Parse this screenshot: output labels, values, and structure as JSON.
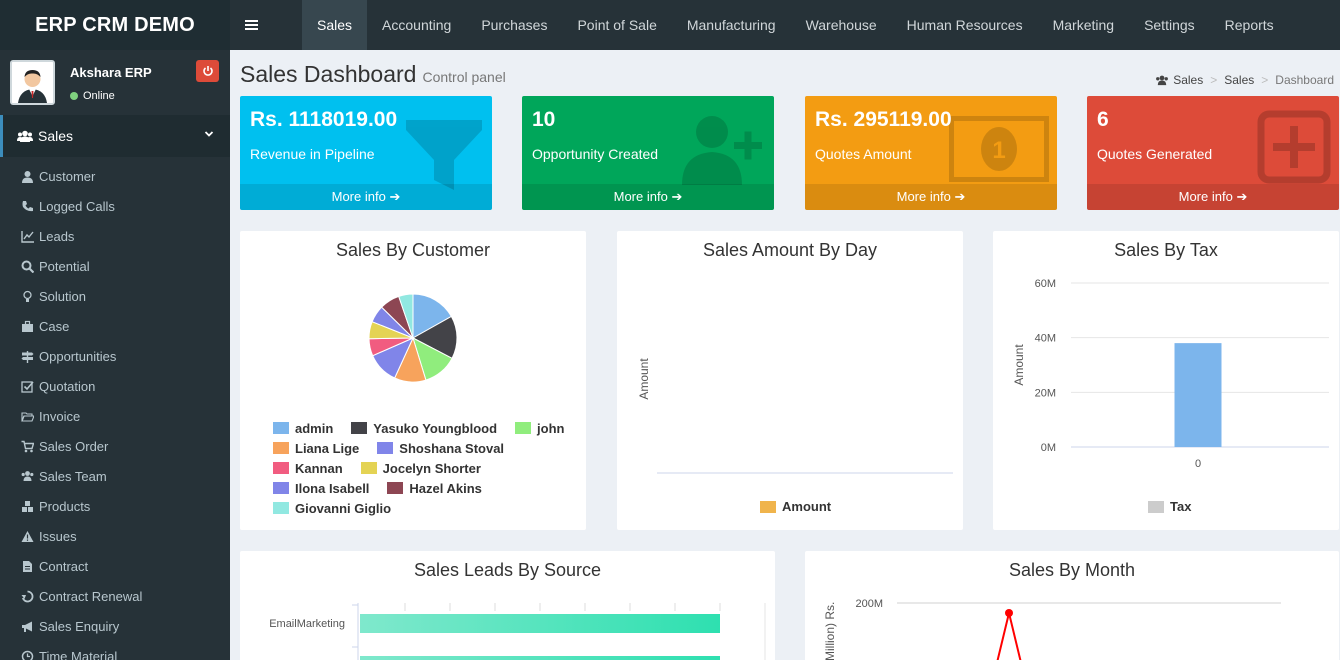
{
  "app": {
    "logo": "ERP CRM DEMO"
  },
  "topnav": [
    {
      "label": "Sales",
      "active": true
    },
    {
      "label": "Accounting"
    },
    {
      "label": "Purchases"
    },
    {
      "label": "Point of Sale"
    },
    {
      "label": "Manufacturing"
    },
    {
      "label": "Warehouse"
    },
    {
      "label": "Human Resources"
    },
    {
      "label": "Marketing"
    },
    {
      "label": "Settings"
    },
    {
      "label": "Reports"
    }
  ],
  "user": {
    "name": "Akshara ERP",
    "status": "Online"
  },
  "sidebar": {
    "section": "Sales",
    "items": [
      {
        "label": "Customer",
        "icon": "user-icon"
      },
      {
        "label": "Logged Calls",
        "icon": "phone-icon"
      },
      {
        "label": "Leads",
        "icon": "line-chart-icon"
      },
      {
        "label": "Potential",
        "icon": "search-icon"
      },
      {
        "label": "Solution",
        "icon": "lightbulb-icon"
      },
      {
        "label": "Case",
        "icon": "briefcase-icon"
      },
      {
        "label": "Opportunities",
        "icon": "signpost-icon"
      },
      {
        "label": "Quotation",
        "icon": "checkbox-icon"
      },
      {
        "label": "Invoice",
        "icon": "folder-open-icon"
      },
      {
        "label": "Sales Order",
        "icon": "cart-icon"
      },
      {
        "label": "Sales Team",
        "icon": "users-icon"
      },
      {
        "label": "Products",
        "icon": "cubes-icon"
      },
      {
        "label": "Issues",
        "icon": "warning-icon"
      },
      {
        "label": "Contract",
        "icon": "document-icon"
      },
      {
        "label": "Contract Renewal",
        "icon": "recycle-icon"
      },
      {
        "label": "Sales Enquiry",
        "icon": "bullhorn-icon"
      },
      {
        "label": "Time Material",
        "icon": "clock-icon"
      }
    ]
  },
  "header": {
    "title": "Sales Dashboard",
    "subtitle": "Control panel"
  },
  "breadcrumb": [
    "Sales",
    "Sales",
    "Dashboard"
  ],
  "stat_boxes": [
    {
      "value": "Rs. 1118019.00",
      "label": "Revenue in Pipeline",
      "footer": "More info",
      "color": "#00c0ef",
      "icon": "funnel-icon"
    },
    {
      "value": "10",
      "label": "Opportunity Created",
      "footer": "More info",
      "color": "#00a65a",
      "icon": "user-plus-icon"
    },
    {
      "value": "Rs. 295119.00",
      "label": "Quotes Amount",
      "footer": "More info",
      "color": "#f39c12",
      "icon": "money-icon"
    },
    {
      "value": "6",
      "label": "Quotes Generated",
      "footer": "More info",
      "color": "#dd4b39",
      "icon": "plus-square-icon"
    }
  ],
  "chart_titles": {
    "customer": "Sales By Customer",
    "day": "Sales Amount By Day",
    "tax": "Sales By Tax",
    "leads": "Sales Leads By Source",
    "month": "Sales By Month"
  },
  "chart_data": [
    {
      "type": "pie",
      "title": "Sales By Customer",
      "labels": [
        "admin",
        "Yasuko Youngblood",
        "john",
        "Liana Lige",
        "Shoshana Stoval",
        "Kannan",
        "Jocelyn Shorter",
        "Ilona Isabell",
        "Hazel Akins",
        "Giovanni Giglio"
      ],
      "values": [
        16,
        15,
        12,
        11,
        11,
        6,
        6,
        6,
        7,
        5
      ],
      "colors": [
        "#7cb5ec",
        "#434348",
        "#90ed7d",
        "#f7a35c",
        "#8085e9",
        "#f15c80",
        "#e4d354",
        "#8085e8",
        "#8d4653",
        "#91e8e1"
      ]
    },
    {
      "type": "line",
      "title": "Sales Amount By Day",
      "ylabel": "Amount",
      "series": [
        {
          "name": "Amount",
          "values": []
        }
      ],
      "colors": [
        "#f0b44c"
      ]
    },
    {
      "type": "bar",
      "title": "Sales By Tax",
      "categories": [
        "0"
      ],
      "ylabel": "Amount",
      "ylim": [
        0,
        60000000
      ],
      "yticks": [
        "0M",
        "20M",
        "40M",
        "60M"
      ],
      "series": [
        {
          "name": "Tax",
          "values": [
            38000000
          ]
        }
      ],
      "colors": [
        "#7cb5ec",
        "#cccccc"
      ]
    },
    {
      "type": "bar",
      "title": "Sales Leads By Source",
      "categories": [
        "EmailMarketing"
      ],
      "series": [
        {
          "values": [
            100
          ]
        }
      ],
      "colors": [
        "#2ee0b0"
      ]
    },
    {
      "type": "line",
      "title": "Sales By Month",
      "ylabel": "Million) Rs.",
      "yticks": [
        "200M"
      ],
      "colors": [
        "#ff0000"
      ]
    }
  ]
}
